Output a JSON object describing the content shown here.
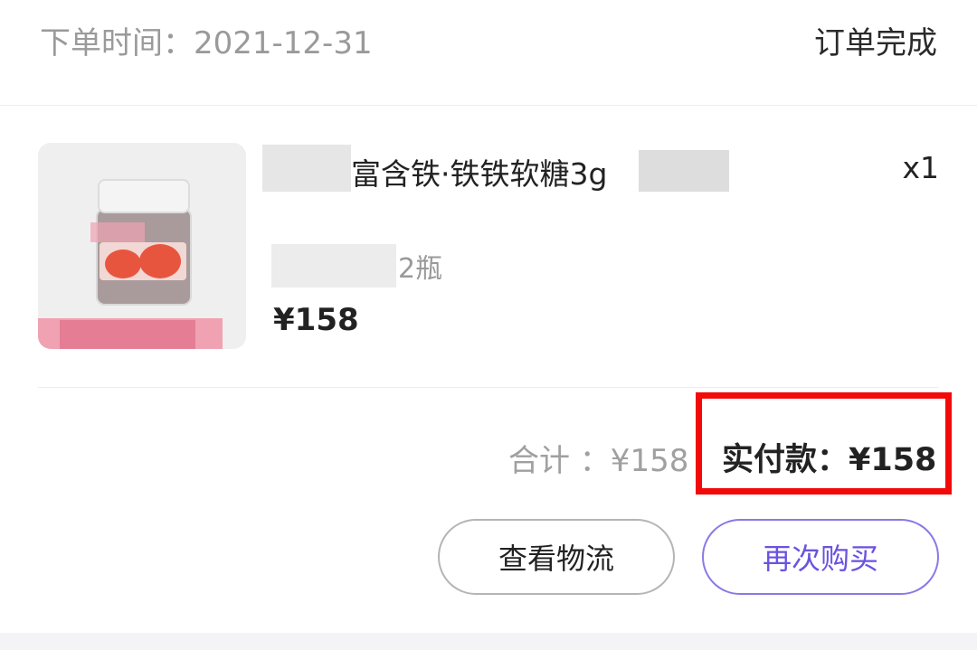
{
  "order": {
    "date_label": "下单时间：2021-12-31",
    "status": "订单完成"
  },
  "product": {
    "title": "富含铁·铁铁软糖3g",
    "quantity": "x1",
    "spec": "2瓶",
    "unit_price": "¥158"
  },
  "summary": {
    "subtotal": "合计 ：¥158",
    "paid": "实付款：¥158"
  },
  "actions": {
    "view_logistics": "查看物流",
    "buy_again": "再次购买"
  },
  "colors": {
    "accent": "#6b52e0",
    "highlight": "#f20a0a",
    "muted_text": "#9a9a9a"
  }
}
